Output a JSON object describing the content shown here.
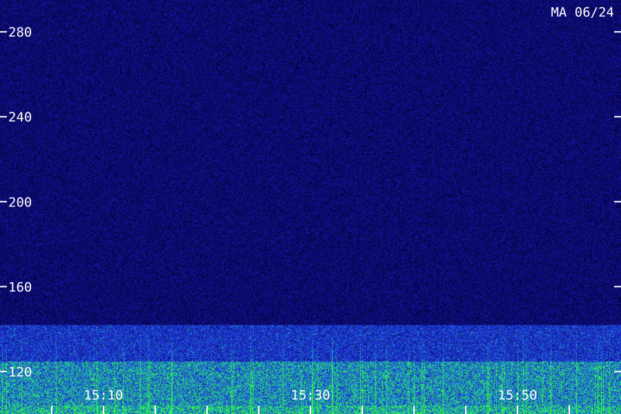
{
  "chart_data": {
    "type": "heatmap",
    "title": "MA 06/24",
    "xlabel": "",
    "ylabel": "",
    "y_range": [
      100,
      295
    ],
    "y_ticks": [
      120,
      160,
      200,
      240,
      280
    ],
    "x_ticks": [
      "15:10",
      "15:30",
      "15:50"
    ],
    "x_minor_ticks": [
      "15:05",
      "15:10",
      "15:15",
      "15:20",
      "15:25",
      "15:30",
      "15:35",
      "15:40",
      "15:45",
      "15:50",
      "15:55"
    ],
    "grid": false,
    "colormap": [
      "#000030",
      "#1414a0",
      "#2040e0",
      "#1a9adc",
      "#30ff40"
    ],
    "bands": [
      {
        "y_from": 100,
        "y_to": 104,
        "intensity": 0.9
      },
      {
        "y_from": 104,
        "y_to": 125,
        "intensity": 0.75
      },
      {
        "y_from": 125,
        "y_to": 142,
        "intensity": 0.45
      },
      {
        "y_from": 142,
        "y_to": 295,
        "intensity": 0.15
      }
    ]
  }
}
